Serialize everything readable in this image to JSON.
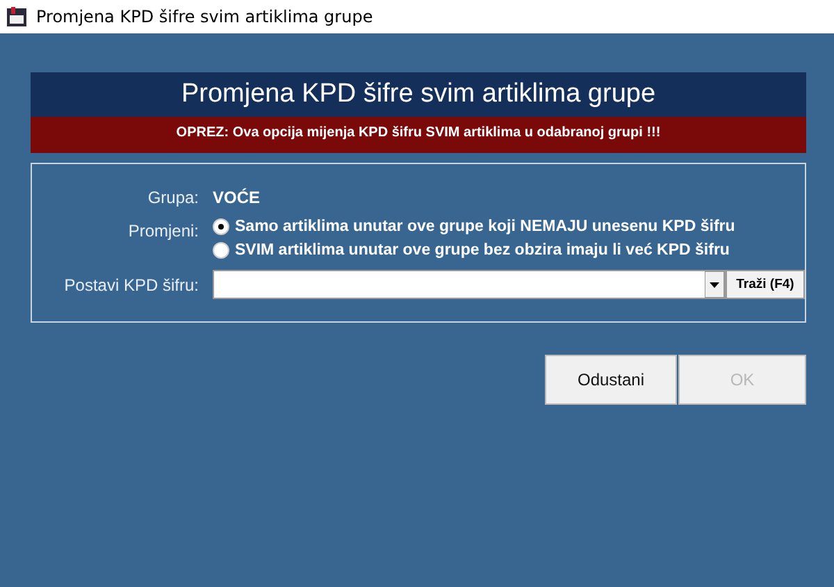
{
  "window": {
    "title": "Promjena KPD šifre svim artiklima grupe"
  },
  "header": {
    "title": "Promjena KPD šifre svim artiklima grupe",
    "warning": "OPREZ: Ova opcija mijenja KPD šifru SVIM artiklima u odabranoj grupi !!!"
  },
  "group": {
    "label": "Grupa:",
    "value": "VOĆE"
  },
  "change": {
    "label": "Promjeni:",
    "options": [
      {
        "label": "Samo artiklima unutar ove grupe koji NEMAJU unesenu KPD šifru",
        "selected": true
      },
      {
        "label": "SVIM artiklima unutar ove grupe bez obzira imaju li već KPD šifru",
        "selected": false
      }
    ]
  },
  "kpd": {
    "label": "Postavi KPD šifru:",
    "search_button": "Traži (F4)"
  },
  "buttons": [
    {
      "label": "Odustani",
      "disabled": false
    },
    {
      "label": "OK",
      "disabled": true
    }
  ]
}
